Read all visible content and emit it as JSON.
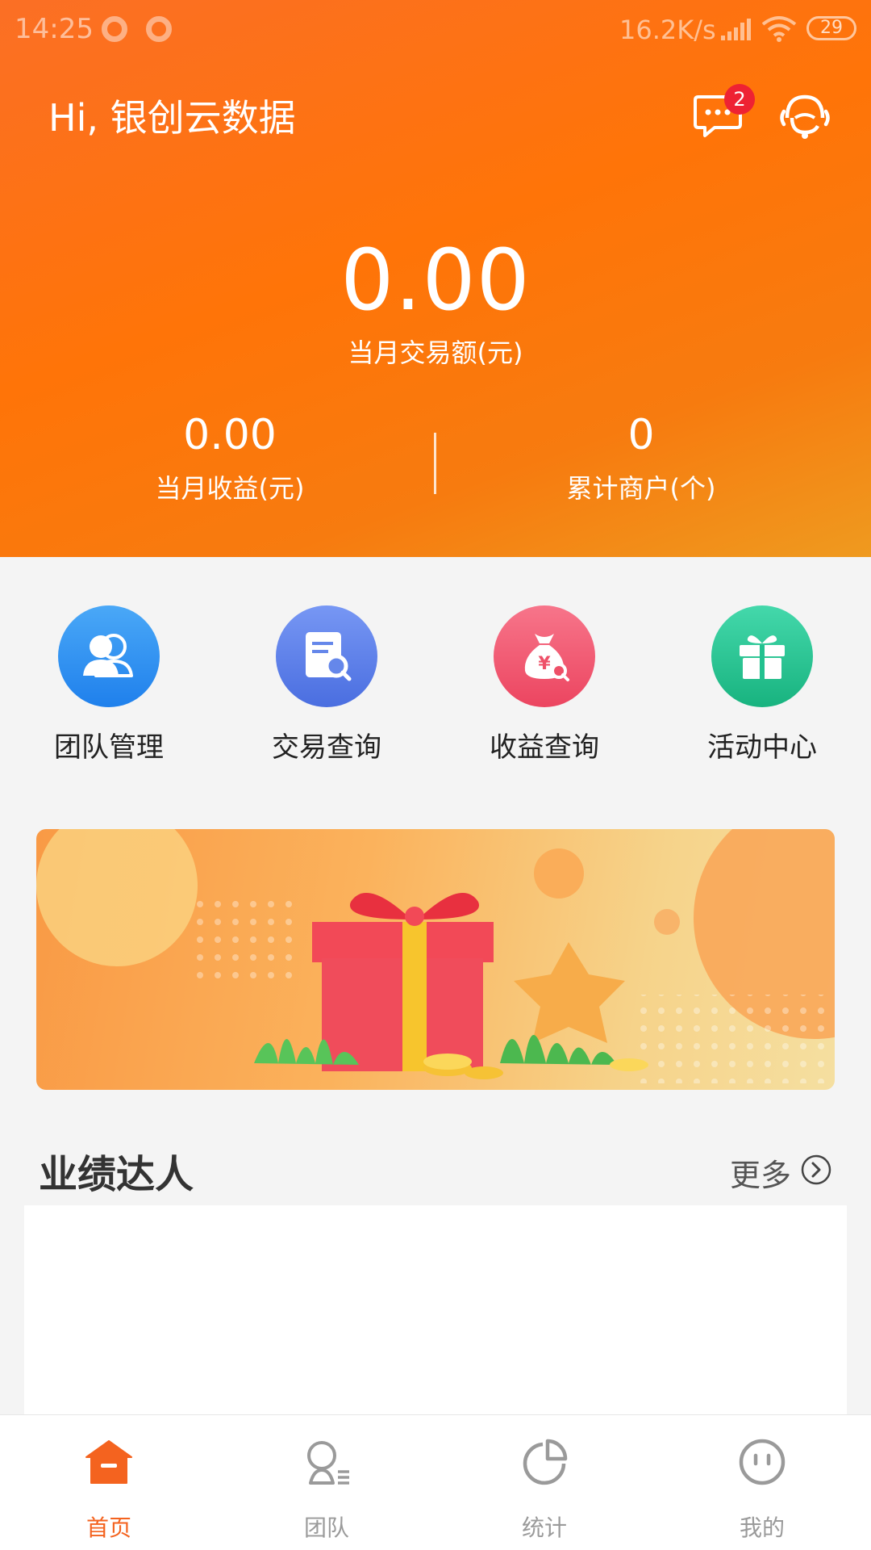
{
  "status_bar": {
    "time": "14:25",
    "net_speed": "16.2K/s",
    "battery": "29"
  },
  "header": {
    "greeting": "Hi, 银创云数据",
    "message_badge": "2",
    "icons": {
      "message": "message-icon",
      "service": "customer-service-icon"
    }
  },
  "summary": {
    "month_amount": "0.00",
    "month_amount_label": "当月交易额(元)",
    "month_income": "0.00",
    "month_income_label": "当月收益(元)",
    "total_merchants": "0",
    "total_merchants_label": "累计商户(个)"
  },
  "menu": [
    {
      "label": "团队管理",
      "icon": "team-icon",
      "color": "#2f8ff0"
    },
    {
      "label": "交易查询",
      "icon": "transaction-search-icon",
      "color": "#5b80ea"
    },
    {
      "label": "收益查询",
      "icon": "income-search-icon",
      "color": "#f0546a"
    },
    {
      "label": "活动中心",
      "icon": "gift-icon",
      "color": "#27c594"
    }
  ],
  "section": {
    "title": "业绩达人",
    "more": "更多"
  },
  "tabbar": [
    {
      "label": "首页",
      "icon": "home-icon",
      "active": true
    },
    {
      "label": "团队",
      "icon": "team-tab-icon",
      "active": false
    },
    {
      "label": "统计",
      "icon": "stats-icon",
      "active": false
    },
    {
      "label": "我的",
      "icon": "profile-icon",
      "active": false
    }
  ],
  "colors": {
    "brand": "#ff7408",
    "active_tab": "#f4631f",
    "inactive_tab": "#9a9a9a"
  }
}
